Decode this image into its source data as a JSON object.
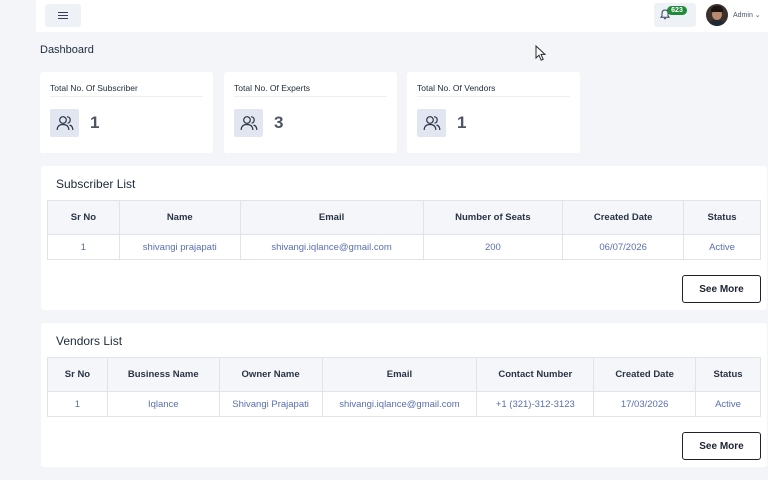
{
  "header": {
    "notification_count": "623",
    "user_name": "Admin"
  },
  "page_title": "Dashboard",
  "stats": [
    {
      "label": "Total No. Of Subscriber",
      "value": "1",
      "icon": "users-icon"
    },
    {
      "label": "Total No. Of Experts",
      "value": "3",
      "icon": "users-icon"
    },
    {
      "label": "Total No. Of Vendors",
      "value": "1",
      "icon": "users-icon"
    }
  ],
  "subscriber_list": {
    "title": "Subscriber List",
    "columns": [
      "Sr No",
      "Name",
      "Email",
      "Number of Seats",
      "Created Date",
      "Status"
    ],
    "rows": [
      [
        "1",
        "shivangi prajapati",
        "shivangi.iqlance@gmail.com",
        "200",
        "06/07/2026",
        "Active"
      ]
    ],
    "see_more": "See More"
  },
  "vendors_list": {
    "title": "Vendors List",
    "columns": [
      "Sr No",
      "Business Name",
      "Owner Name",
      "Email",
      "Contact Number",
      "Created Date",
      "Status"
    ],
    "rows": [
      [
        "1",
        "Iqlance",
        "Shivangi Prajapati",
        "shivangi.iqlance@gmail.com",
        "+1 (321)-312-3123",
        "17/03/2026",
        "Active"
      ]
    ],
    "see_more": "See More"
  },
  "colors": {
    "badge": "#1e8a3a",
    "link_text": "#5a6fb0",
    "background": "#f3f5f9"
  }
}
